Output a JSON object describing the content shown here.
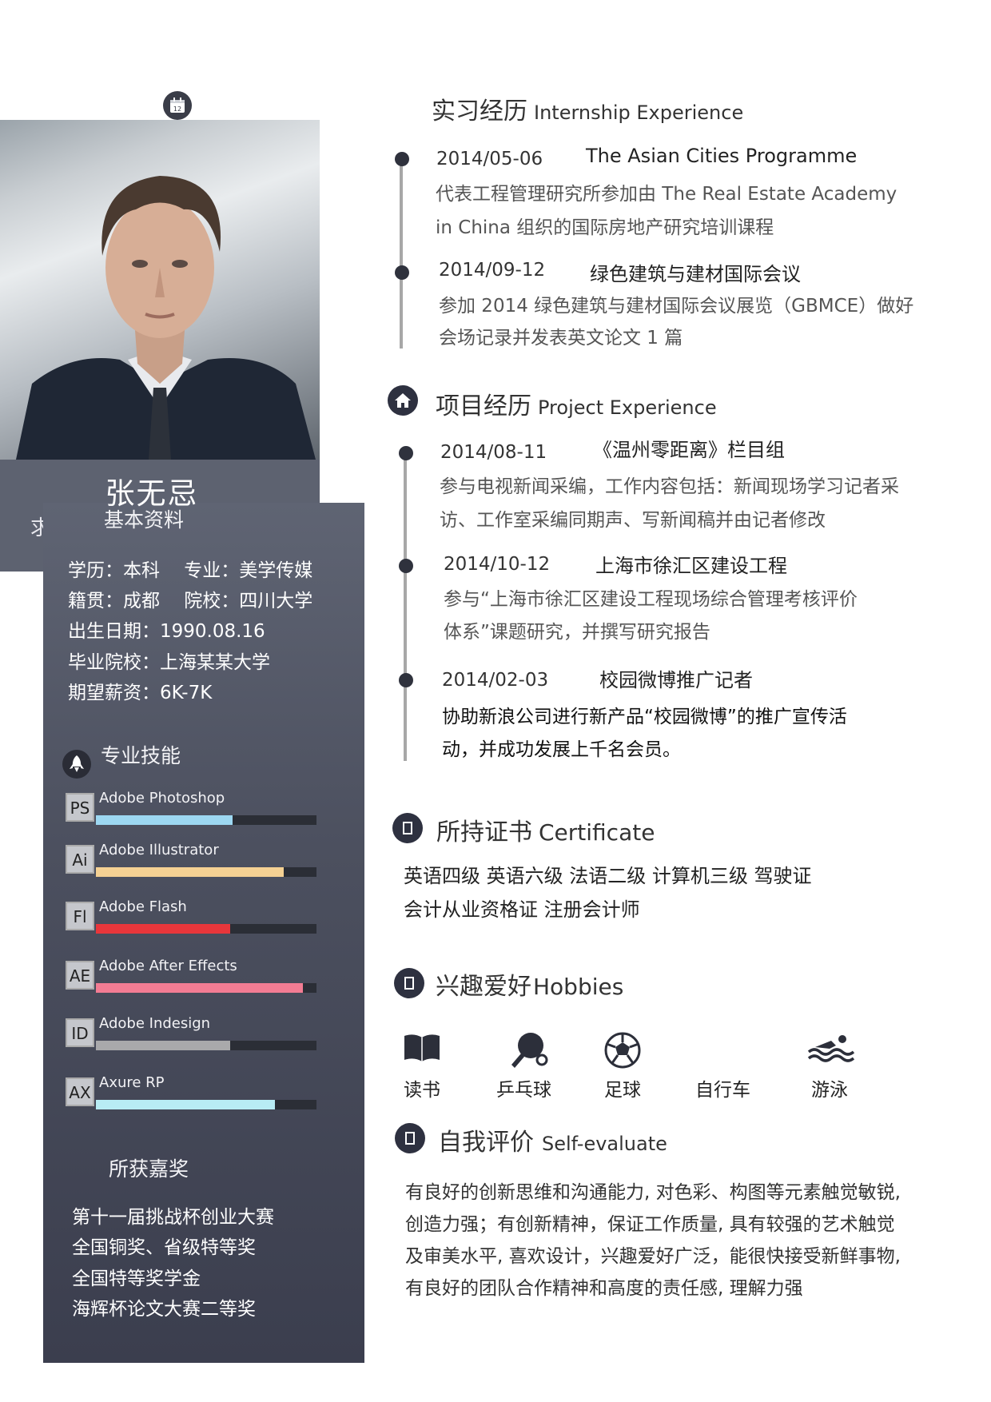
{
  "profile": {
    "name": "张无忌",
    "name_sub": "求",
    "basic_title": "基本资料",
    "info": [
      "学历：本科　 专业：美学传媒",
      "籍贯：成都　 院校：四川大学",
      "出生日期：1990.08.16",
      "毕业院校：上海某某大学",
      "期望薪资：6K-7K"
    ]
  },
  "skills": {
    "title": "专业技能",
    "items": [
      {
        "abbr": "PS",
        "name": "Adobe Photoshop",
        "level": 0.62,
        "color": "#9dd8f2"
      },
      {
        "abbr": "Ai",
        "name": "Adobe Illustrator",
        "level": 0.85,
        "color": "#f5d193"
      },
      {
        "abbr": "Fl",
        "name": "Adobe Flash",
        "level": 0.61,
        "color": "#e8363b"
      },
      {
        "abbr": "AE",
        "name": "Adobe After Effects",
        "level": 0.94,
        "color": "#f37c93"
      },
      {
        "abbr": "ID",
        "name": "Adobe Indesign",
        "level": 0.61,
        "color": "#a9a9ab"
      },
      {
        "abbr": "AX",
        "name": "Axure  RP",
        "level": 0.81,
        "color": "#b8ecf4"
      }
    ]
  },
  "awards": {
    "title": "所获嘉奖",
    "lines": [
      "第十一届挑战杯创业大赛",
      "全国铜奖、省级特等奖",
      "全国特等奖学金",
      "海辉杯论文大赛二等奖"
    ]
  },
  "internship": {
    "title": "实习经历",
    "title_en": "Internship Experience",
    "items": [
      {
        "date": "2014/05-06",
        "title": "The Asian Cities Programme",
        "desc": [
          "代表工程管理研究所参加由 The Real Estate Academy",
          "in China  组织的国际房地产研究培训课程"
        ]
      },
      {
        "date": "2014/09-12",
        "title": "绿色建筑与建材国际会议",
        "desc": [
          "参加 2014 绿色建筑与建材国际会议展览（GBMCE）做好",
          "会场记录并发表英文论文 1 篇"
        ]
      }
    ]
  },
  "project": {
    "title": "项目经历",
    "title_en": "Project Experience",
    "items": [
      {
        "date": "2014/08-11",
        "title": "《温州零距离》栏目组",
        "desc": [
          "参与电视新闻采编，工作内容包括：新闻现场学习记者采",
          "访、工作室采编同期声、写新闻稿并由记者修改"
        ]
      },
      {
        "date": "2014/10-12",
        "title": "上海市徐汇区建设工程",
        "desc": [
          "参与“上海市徐汇区建设工程现场综合管理考核评价",
          "体系”课题研究，并撰写研究报告"
        ]
      },
      {
        "date": "2014/02-03",
        "title": "校园微博推广记者",
        "desc": [
          "协助新浪公司进行新产品“校园微博”的推广宣传活",
          "动，并成功发展上千名会员。"
        ]
      }
    ]
  },
  "certificate": {
    "title": "所持证书",
    "title_en": "Certificate",
    "lines": [
      "英语四级  英语六级  法语二级 计算机三级  驾驶证",
      "会计从业资格证  注册会计师"
    ]
  },
  "hobbies": {
    "title": "兴趣爱好",
    "title_en": "Hobbies",
    "items": [
      {
        "label": "读书",
        "icon": "book-icon"
      },
      {
        "label": "乒乓球",
        "icon": "ping-pong-icon"
      },
      {
        "label": "足球",
        "icon": "football-icon"
      },
      {
        "label": "自行车",
        "icon": "bicycle-icon"
      },
      {
        "label": "游泳",
        "icon": "swimming-icon"
      }
    ]
  },
  "self_evaluate": {
    "title": "自我评价",
    "title_en": "Self-evaluate",
    "lines": [
      "有良好的创新思维和沟通能力, 对色彩、构图等元素触觉敏锐,",
      "创造力强；有创新精神，保证工作质量, 具有较强的艺术触觉",
      "及审美水平, 喜欢设计，兴趣爱好广泛，能很快接受新鲜事物,",
      "有良好的团队合作精神和高度的责任感, 理解力强"
    ]
  }
}
